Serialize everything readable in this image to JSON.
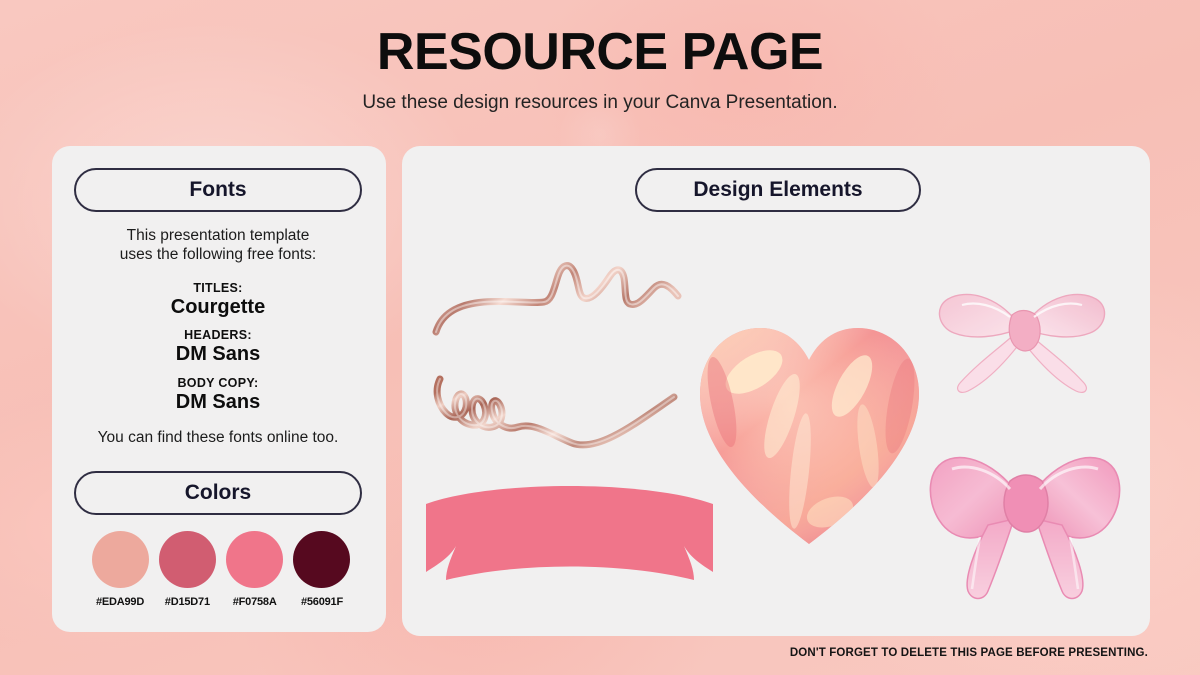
{
  "header": {
    "title": "RESOURCE PAGE",
    "subtitle": "Use these design resources in your Canva Presentation."
  },
  "fonts_panel": {
    "heading": "Fonts",
    "intro_line_1": "This presentation template",
    "intro_line_2": "uses the following free fonts:",
    "groups": [
      {
        "role": "TITLES:",
        "name": "Courgette"
      },
      {
        "role": "HEADERS:",
        "name": "DM Sans"
      },
      {
        "role": "BODY COPY:",
        "name": "DM Sans"
      }
    ],
    "outro": "You can find these fonts online too."
  },
  "colors_panel": {
    "heading": "Colors",
    "swatches": [
      {
        "hex": "#EDA99D"
      },
      {
        "hex": "#D15D71"
      },
      {
        "hex": "#F0758A"
      },
      {
        "hex": "#56091F"
      }
    ]
  },
  "design_panel": {
    "heading": "Design Elements",
    "elements": [
      {
        "name": "curly-ribbon-streamer-1"
      },
      {
        "name": "curly-ribbon-streamer-2"
      },
      {
        "name": "glossy-heart"
      },
      {
        "name": "pink-banner-ribbon"
      },
      {
        "name": "sheer-ribbon-bow-small"
      },
      {
        "name": "pink-ribbon-bow-large"
      }
    ]
  },
  "footer": {
    "note": "DON'T FORGET TO DELETE THIS PAGE BEFORE PRESENTING."
  },
  "palette": {
    "background_pink": "#F8C4BB",
    "panel_gray": "#F1F0F0",
    "outline_navy": "#2F2D42",
    "banner_pink": "#F0758A",
    "text_dark": "#0D0D0D"
  }
}
